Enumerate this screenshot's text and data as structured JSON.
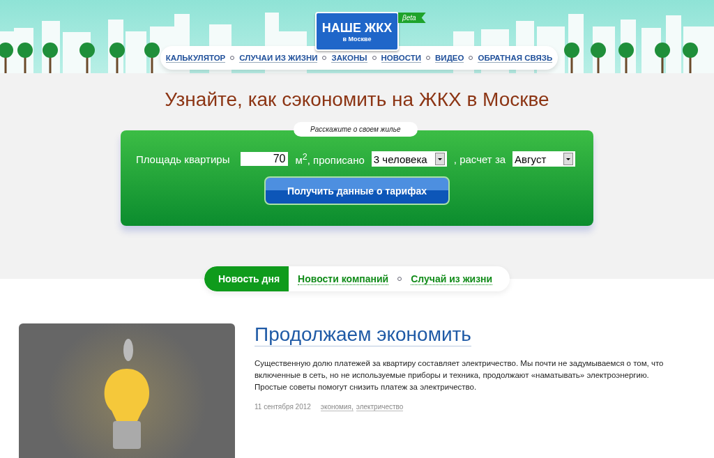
{
  "logo": {
    "title": "НАШЕ ЖКХ",
    "subtitle": "в Москве",
    "badge": "βeta"
  },
  "nav": [
    {
      "label": "КАЛЬКУЛЯТОР"
    },
    {
      "label": "СЛУЧАИ ИЗ ЖИЗНИ"
    },
    {
      "label": "ЗАКОНЫ"
    },
    {
      "label": "НОВОСТИ"
    },
    {
      "label": "ВИДЕО"
    },
    {
      "label": "ОБРАТНАЯ СВЯЗЬ"
    }
  ],
  "headline": "Узнайте, как сэкономить на ЖКХ в Москве",
  "form": {
    "caption": "Расскажите о своем жилье",
    "area_label": "Площадь квартиры",
    "area_value": "70",
    "unit_label": "м$^{2}$, прописано",
    "people_value": "3 человека",
    "period_label": ", расчет за",
    "month_value": "Август",
    "submit": "Получить данные о тарифах"
  },
  "tabs": [
    {
      "label": "Новость дня",
      "selected": true
    },
    {
      "label": "Новости компаний",
      "selected": false
    },
    {
      "label": "Случай из жизни",
      "selected": false
    }
  ],
  "article": {
    "title": "Продолжаем экономить",
    "body": "Существенную долю платежей за квартиру составляет электричество. Мы почти не задумываемся о том, что включенные в сеть, но не используемые приборы и техника, продолжают «наматывать» электроэнергию. Простые советы помогут снизить платеж за электричество.",
    "date": "11 сентября 2012",
    "tags": [
      "экономия,",
      "электричество"
    ]
  }
}
